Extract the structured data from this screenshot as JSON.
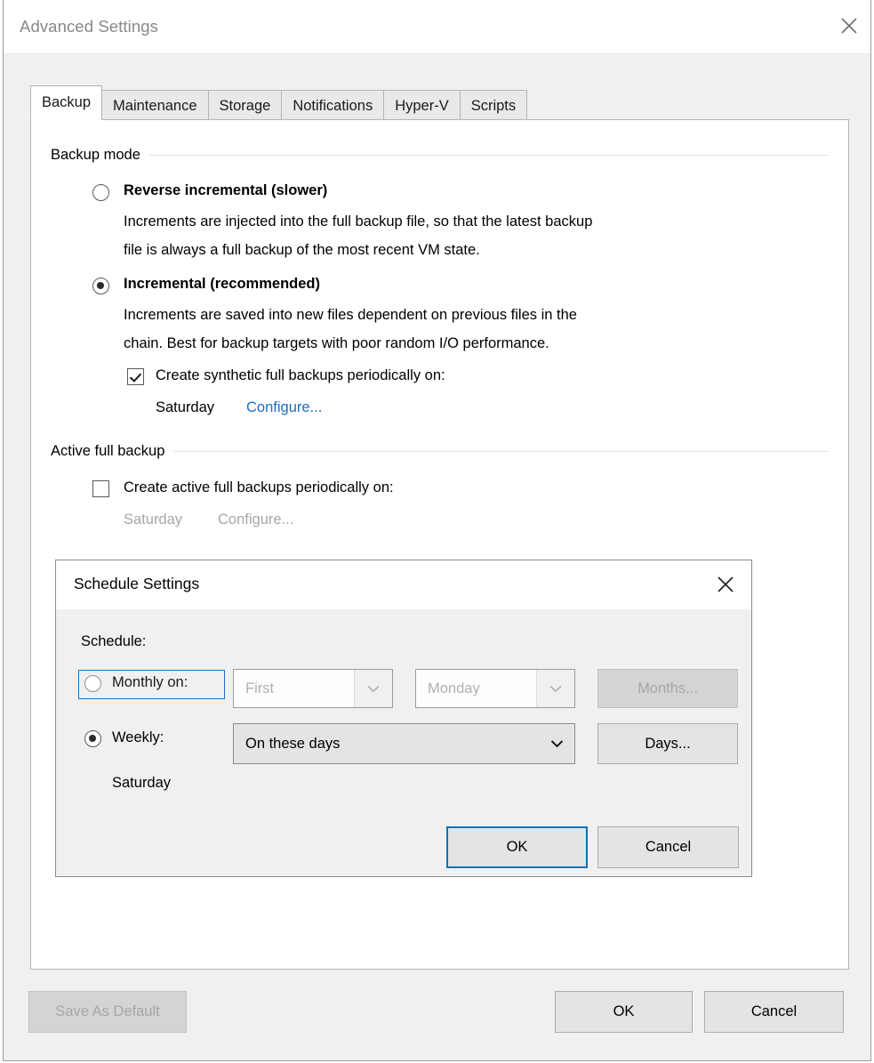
{
  "window": {
    "title": "Advanced Settings",
    "close_icon": "close-icon"
  },
  "tabs": [
    {
      "label": "Backup",
      "active": true
    },
    {
      "label": "Maintenance",
      "active": false
    },
    {
      "label": "Storage",
      "active": false
    },
    {
      "label": "Notifications",
      "active": false
    },
    {
      "label": "Hyper-V",
      "active": false
    },
    {
      "label": "Scripts",
      "active": false
    }
  ],
  "backup_mode": {
    "group_label": "Backup mode",
    "reverse": {
      "title": "Reverse incremental (slower)",
      "description_line1": "Increments are injected into the full backup file, so that the latest backup",
      "description_line2": "file is always a full backup of the most recent VM state.",
      "selected": false
    },
    "incremental": {
      "title": "Incremental (recommended)",
      "description_line1": "Increments are saved into new files dependent on previous files in the",
      "description_line2": "chain. Best for backup targets with poor random I/O performance.",
      "selected": true
    },
    "synthetic": {
      "checkbox_label": "Create synthetic full backups periodically on:",
      "checked": true,
      "day_value": "Saturday",
      "configure_link": "Configure..."
    }
  },
  "active_full_backup": {
    "group_label": "Active full backup",
    "checkbox_label": "Create active full backups periodically on:",
    "checked": false,
    "day_value": "Saturday",
    "configure_link": "Configure..."
  },
  "schedule_dialog": {
    "title": "Schedule Settings",
    "close_icon": "close-icon",
    "schedule_label": "Schedule:",
    "monthly": {
      "radio_label": "Monthly on:",
      "selected": false,
      "focused": true,
      "ordinal_value": "First",
      "weekday_value": "Monday",
      "months_button": "Months...",
      "enabled": false
    },
    "weekly": {
      "radio_label": "Weekly:",
      "selected": true,
      "mode_value": "On these days",
      "days_button": "Days...",
      "days_value": "Saturday",
      "enabled": true
    },
    "ok_button": "OK",
    "cancel_button": "Cancel"
  },
  "footer": {
    "save_as_default_button": "Save As Default",
    "save_as_default_disabled": true,
    "ok_button": "OK",
    "cancel_button": "Cancel"
  },
  "colors": {
    "accent": "#0a73b8",
    "link": "#1a6fc4",
    "disabled_text": "#a6a6a6",
    "panel_bg": "#ffffff",
    "dialog_bg": "#f0f0f0"
  }
}
